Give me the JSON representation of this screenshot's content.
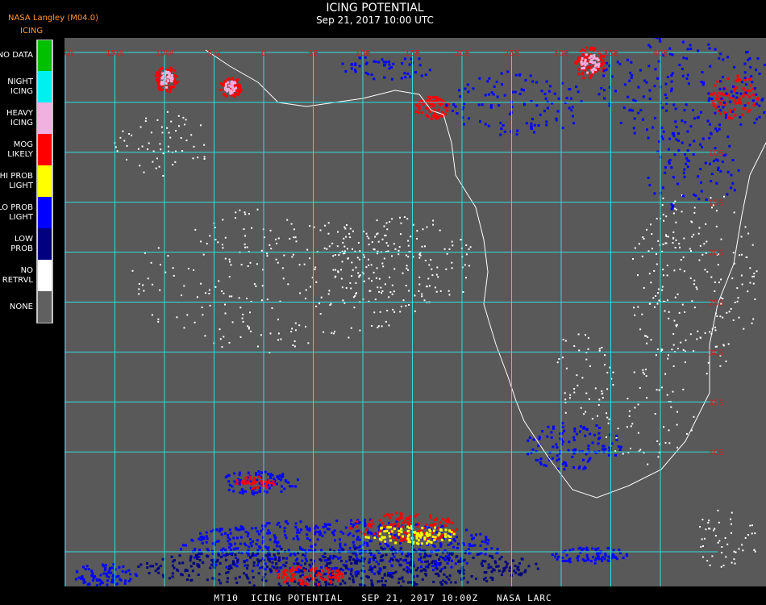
{
  "header": {
    "source": "NASA Langley (M04.0)",
    "product_short": "ICING",
    "title": "ICING POTENTIAL",
    "datetime": "Sep 21, 2017 10:00 UTC"
  },
  "legend": {
    "items": [
      {
        "label_lines": [
          "NO DATA"
        ],
        "color": "#00c000"
      },
      {
        "label_lines": [
          "NIGHT",
          "ICING"
        ],
        "color": "#00f0f0"
      },
      {
        "label_lines": [
          "HEAVY",
          "ICING"
        ],
        "color": "#f0b0e0"
      },
      {
        "label_lines": [
          "MOG",
          "LIKELY"
        ],
        "color": "#ff0000"
      },
      {
        "label_lines": [
          "HI PROB",
          "LIGHT"
        ],
        "color": "#ffff00"
      },
      {
        "label_lines": [
          "LO PROB",
          "LIGHT"
        ],
        "color": "#0000ff"
      },
      {
        "label_lines": [
          "LOW",
          "PROB"
        ],
        "color": "#000080"
      },
      {
        "label_lines": [
          "NO",
          "RETRVL"
        ],
        "color": "#ffffff"
      },
      {
        "label_lines": [
          "NONE"
        ],
        "color": "#606060"
      }
    ]
  },
  "map": {
    "background_color": "#595959",
    "grid_color": "#33dddd",
    "label_color": "#cc2222",
    "coast_color": "#ffffff",
    "longitude_labels": [
      "20W",
      "15W",
      "10W",
      "5W",
      "0",
      "5E",
      "10E",
      "15E",
      "20E",
      "25E",
      "30E",
      "35E",
      "40E"
    ],
    "latitude_labels": [
      "5S",
      "10S",
      "15S",
      "20S",
      "25S",
      "30S",
      "35S",
      "40S"
    ]
  },
  "footer": {
    "text": "MT10  ICING POTENTIAL   SEP 21, 2017 10:00Z   NASA LARC"
  }
}
